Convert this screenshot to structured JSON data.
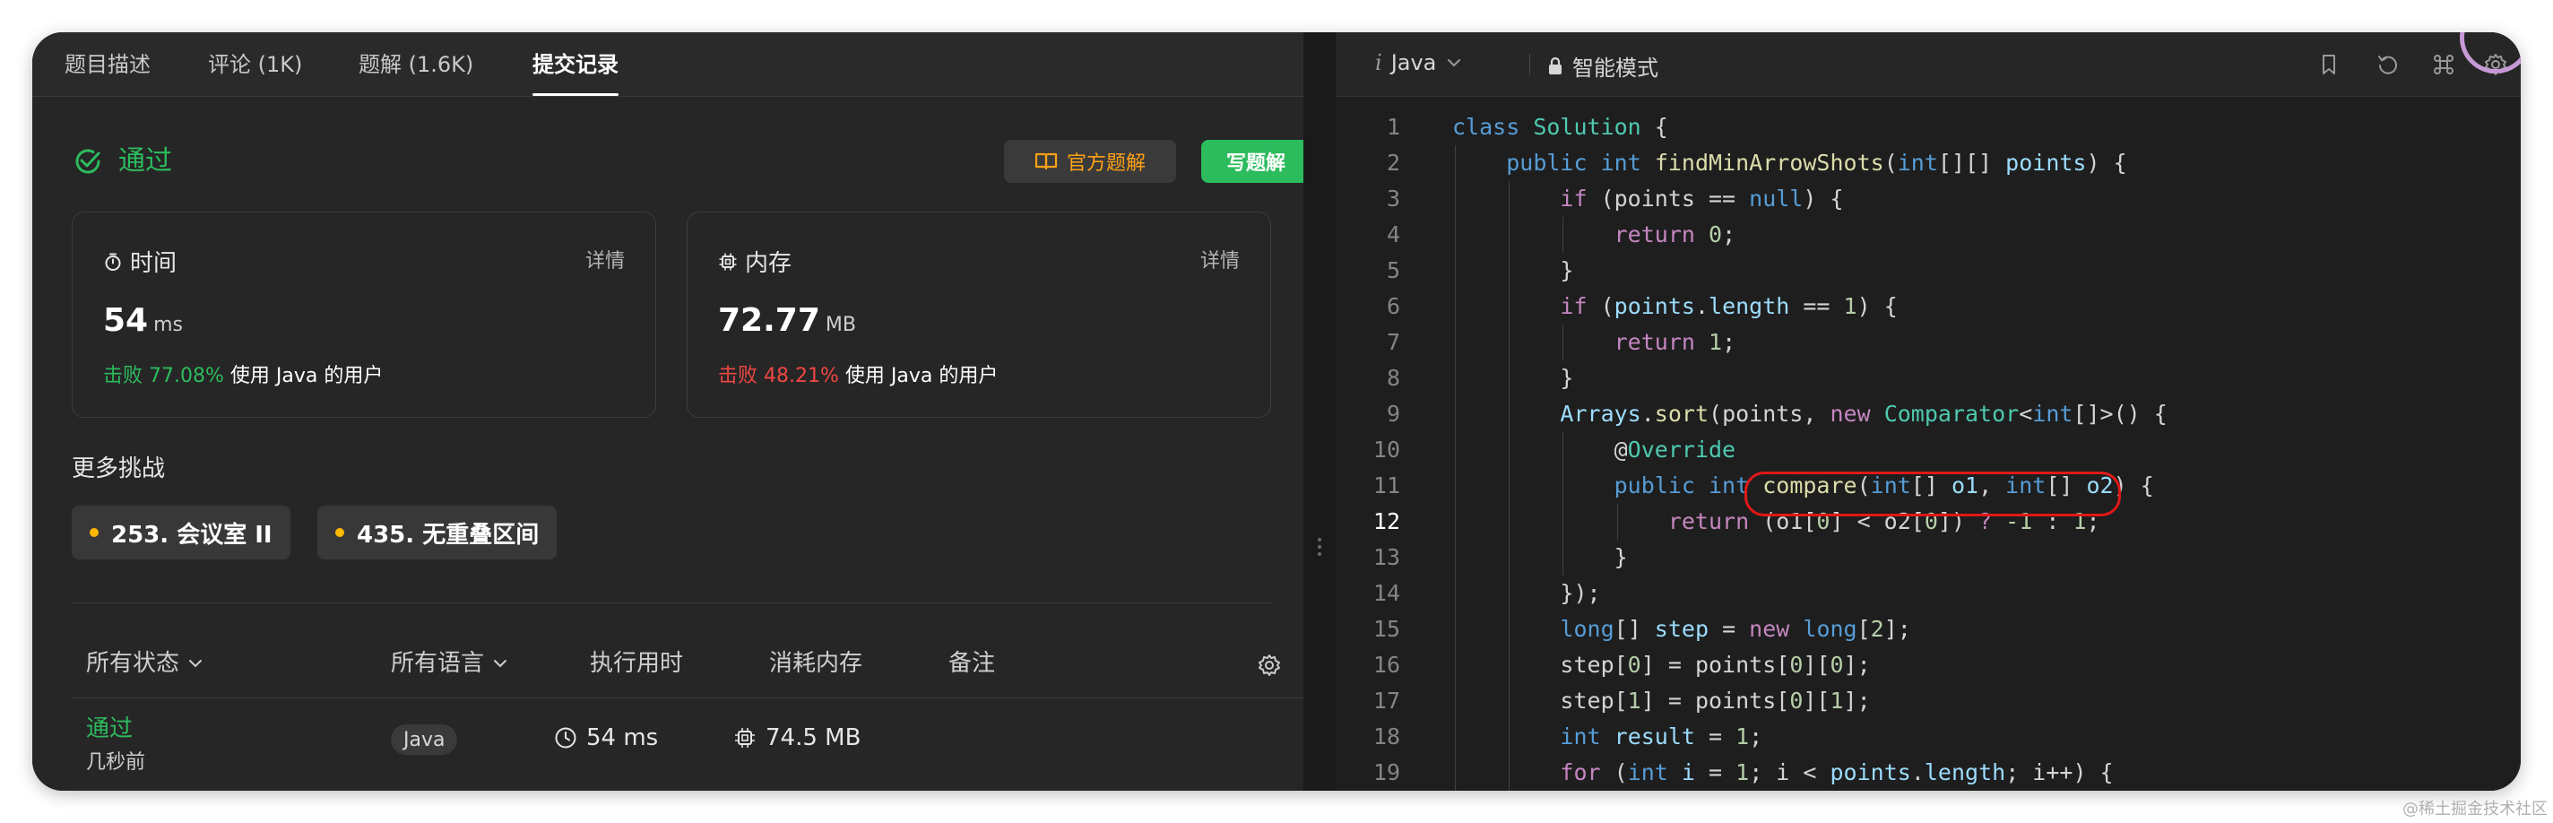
{
  "tabs": [
    {
      "label": "题目描述"
    },
    {
      "label": "评论 (1K)"
    },
    {
      "label": "题解 (1.6K)"
    },
    {
      "label": "提交记录"
    }
  ],
  "result": {
    "status": "通过",
    "official_solution_label": "官方题解",
    "write_solution_label": "写题解"
  },
  "runtime_card": {
    "title": "时间",
    "detail": "详情",
    "value": "54",
    "unit": "ms",
    "beat_label": "击败 77.08%",
    "beat_suffix": "使用 Java 的用户"
  },
  "memory_card": {
    "title": "内存",
    "detail": "详情",
    "value": "72.77",
    "unit": "MB",
    "beat_label": "击败 48.21%",
    "beat_suffix": "使用 Java 的用户"
  },
  "more_challenges": {
    "title": "更多挑战",
    "items": [
      {
        "label": "253. 会议室 II"
      },
      {
        "label": "435. 无重叠区间"
      }
    ]
  },
  "submissions": {
    "headers": {
      "status": "所有状态",
      "language": "所有语言",
      "runtime": "执行用时",
      "memory": "消耗内存",
      "notes": "备注"
    },
    "rows": [
      {
        "status": "通过",
        "time": "几秒前",
        "language": "Java",
        "runtime": "54 ms",
        "memory": "74.5 MB"
      }
    ]
  },
  "editor": {
    "language_icon": "i",
    "language": "Java",
    "mode": "智能模式",
    "current_line": 12,
    "code_lines": [
      {
        "n": "1",
        "tokens": [
          [
            "kw",
            "class"
          ],
          [
            "p",
            " "
          ],
          [
            "type",
            "Solution"
          ],
          [
            "p",
            " {"
          ]
        ]
      },
      {
        "n": "2",
        "tokens": [
          [
            "p",
            "    "
          ],
          [
            "kw",
            "public"
          ],
          [
            "p",
            " "
          ],
          [
            "kw",
            "int"
          ],
          [
            "p",
            " "
          ],
          [
            "fn",
            "findMinArrowShots"
          ],
          [
            "p",
            "("
          ],
          [
            "kw",
            "int"
          ],
          [
            "p",
            "[][] "
          ],
          [
            "var",
            "points"
          ],
          [
            "p",
            ") {"
          ]
        ]
      },
      {
        "n": "3",
        "tokens": [
          [
            "p",
            "        "
          ],
          [
            "ctl",
            "if"
          ],
          [
            "p",
            " (points == "
          ],
          [
            "kw",
            "null"
          ],
          [
            "p",
            ") {"
          ]
        ]
      },
      {
        "n": "4",
        "tokens": [
          [
            "p",
            "            "
          ],
          [
            "ctl",
            "return"
          ],
          [
            "p",
            " "
          ],
          [
            "num",
            "0"
          ],
          [
            "p",
            ";"
          ]
        ]
      },
      {
        "n": "5",
        "tokens": [
          [
            "p",
            "        }"
          ]
        ]
      },
      {
        "n": "6",
        "tokens": [
          [
            "p",
            "        "
          ],
          [
            "ctl",
            "if"
          ],
          [
            "p",
            " ("
          ],
          [
            "var",
            "points"
          ],
          [
            "p",
            "."
          ],
          [
            "var",
            "length"
          ],
          [
            "p",
            " == "
          ],
          [
            "num",
            "1"
          ],
          [
            "p",
            ") {"
          ]
        ]
      },
      {
        "n": "7",
        "tokens": [
          [
            "p",
            "            "
          ],
          [
            "ctl",
            "return"
          ],
          [
            "p",
            " "
          ],
          [
            "num",
            "1"
          ],
          [
            "p",
            ";"
          ]
        ]
      },
      {
        "n": "8",
        "tokens": [
          [
            "p",
            "        }"
          ]
        ]
      },
      {
        "n": "9",
        "tokens": [
          [
            "p",
            "        "
          ],
          [
            "var",
            "Arrays"
          ],
          [
            "p",
            "."
          ],
          [
            "fn",
            "sort"
          ],
          [
            "p",
            "(points, "
          ],
          [
            "ctl",
            "new"
          ],
          [
            "p",
            " "
          ],
          [
            "type",
            "Comparator"
          ],
          [
            "p",
            "<"
          ],
          [
            "kw",
            "int"
          ],
          [
            "p",
            "[]>() {"
          ]
        ]
      },
      {
        "n": "10",
        "tokens": [
          [
            "p",
            "            @"
          ],
          [
            "type",
            "Override"
          ]
        ]
      },
      {
        "n": "11",
        "tokens": [
          [
            "p",
            "            "
          ],
          [
            "kw",
            "public"
          ],
          [
            "p",
            " "
          ],
          [
            "kw",
            "int"
          ],
          [
            "p",
            " "
          ],
          [
            "fn",
            "compare"
          ],
          [
            "p",
            "("
          ],
          [
            "kw",
            "int"
          ],
          [
            "p",
            "[] "
          ],
          [
            "var",
            "o1"
          ],
          [
            "p",
            ", "
          ],
          [
            "kw",
            "int"
          ],
          [
            "p",
            "[] "
          ],
          [
            "var",
            "o2"
          ],
          [
            "p",
            ") {"
          ]
        ]
      },
      {
        "n": "12",
        "tokens": [
          [
            "p",
            "                "
          ],
          [
            "ctl",
            "return"
          ],
          [
            "p",
            " (o1["
          ],
          [
            "num",
            "0"
          ],
          [
            "p",
            "] < o2["
          ],
          [
            "num",
            "0"
          ],
          [
            "p",
            "]) "
          ],
          [
            "ctl",
            "?"
          ],
          [
            "p",
            " "
          ],
          [
            "num",
            "-1"
          ],
          [
            "p",
            " : "
          ],
          [
            "num",
            "1"
          ],
          [
            "p",
            ";"
          ]
        ]
      },
      {
        "n": "13",
        "tokens": [
          [
            "p",
            "            }"
          ]
        ]
      },
      {
        "n": "14",
        "tokens": [
          [
            "p",
            "        });"
          ]
        ]
      },
      {
        "n": "15",
        "tokens": [
          [
            "p",
            "        "
          ],
          [
            "kw",
            "long"
          ],
          [
            "p",
            "[] "
          ],
          [
            "var",
            "step"
          ],
          [
            "p",
            " = "
          ],
          [
            "ctl",
            "new"
          ],
          [
            "p",
            " "
          ],
          [
            "kw",
            "long"
          ],
          [
            "p",
            "["
          ],
          [
            "num",
            "2"
          ],
          [
            "p",
            "];"
          ]
        ]
      },
      {
        "n": "16",
        "tokens": [
          [
            "p",
            "        step["
          ],
          [
            "num",
            "0"
          ],
          [
            "p",
            "] = points["
          ],
          [
            "num",
            "0"
          ],
          [
            "p",
            "]["
          ],
          [
            "num",
            "0"
          ],
          [
            "p",
            "];"
          ]
        ]
      },
      {
        "n": "17",
        "tokens": [
          [
            "p",
            "        step["
          ],
          [
            "num",
            "1"
          ],
          [
            "p",
            "] = points["
          ],
          [
            "num",
            "0"
          ],
          [
            "p",
            "]["
          ],
          [
            "num",
            "1"
          ],
          [
            "p",
            "];"
          ]
        ]
      },
      {
        "n": "18",
        "tokens": [
          [
            "p",
            "        "
          ],
          [
            "kw",
            "int"
          ],
          [
            "p",
            " "
          ],
          [
            "var",
            "result"
          ],
          [
            "p",
            " = "
          ],
          [
            "num",
            "1"
          ],
          [
            "p",
            ";"
          ]
        ]
      },
      {
        "n": "19",
        "tokens": [
          [
            "p",
            "        "
          ],
          [
            "ctl",
            "for"
          ],
          [
            "p",
            " ("
          ],
          [
            "kw",
            "int"
          ],
          [
            "p",
            " "
          ],
          [
            "var",
            "i"
          ],
          [
            "p",
            " = "
          ],
          [
            "num",
            "1"
          ],
          [
            "p",
            "; i < "
          ],
          [
            "var",
            "points"
          ],
          [
            "p",
            "."
          ],
          [
            "var",
            "length"
          ],
          [
            "p",
            "; i++) {"
          ]
        ]
      }
    ]
  },
  "watermark": "@稀土掘金技术社区",
  "colors": {
    "accept_green": "#2cbb5d",
    "beat_red": "#ef4743",
    "official_orange": "#ffa116",
    "highlight_red": "#e01818"
  }
}
